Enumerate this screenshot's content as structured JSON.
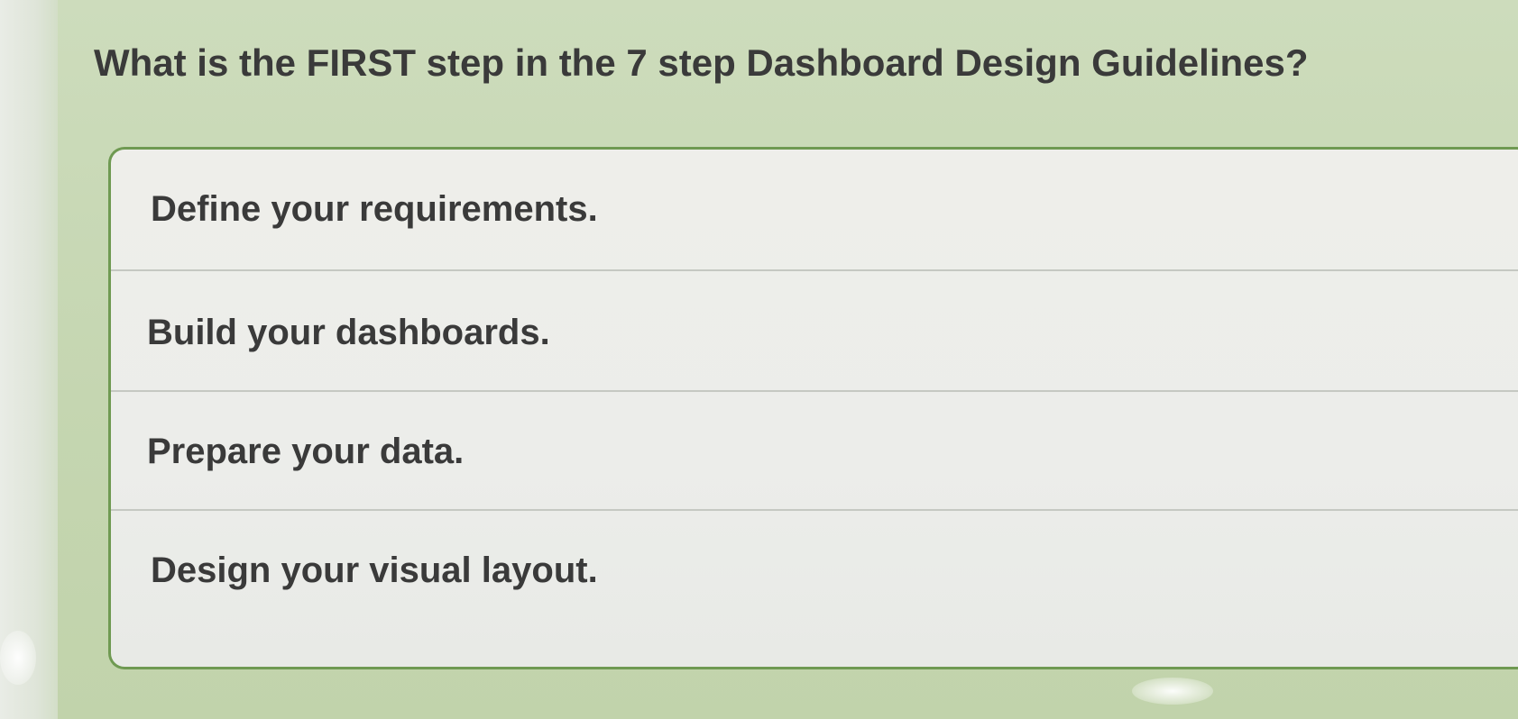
{
  "question": {
    "text": "What is the FIRST step in the 7 step Dashboard Design Guidelines?"
  },
  "options": [
    {
      "label": "Define your requirements."
    },
    {
      "label": "Build your dashboards."
    },
    {
      "label": "Prepare your data."
    },
    {
      "label": "Design your visual layout."
    }
  ],
  "colors": {
    "background": "#c9d8b6",
    "option_border": "#6f9a52",
    "option_fill": "#ecedea",
    "text": "#3a3a3a"
  }
}
